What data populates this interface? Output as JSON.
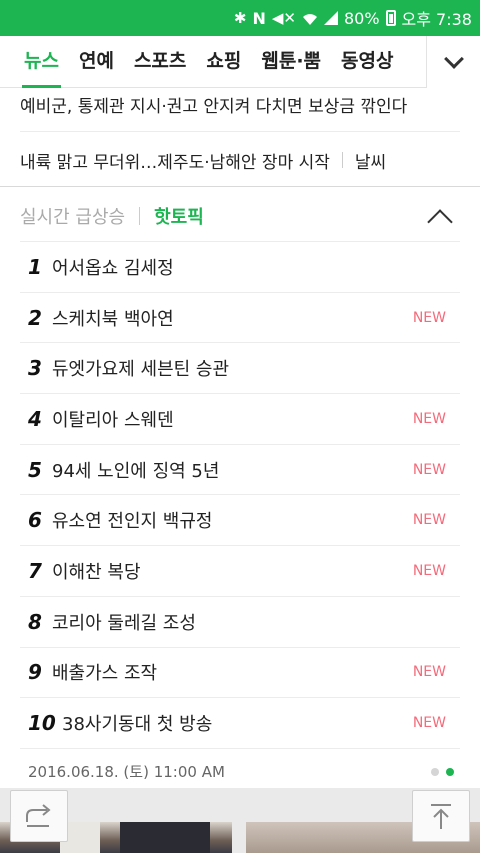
{
  "status_bar": {
    "battery": "80%",
    "time": "오후 7:38",
    "icons": [
      "bluetooth-icon",
      "n-icon",
      "mute-icon",
      "wifi-icon",
      "signal-icon",
      "battery-icon"
    ]
  },
  "tabs": [
    {
      "label": "뉴스",
      "active": true
    },
    {
      "label": "연예"
    },
    {
      "label": "스포츠"
    },
    {
      "label": "쇼핑"
    },
    {
      "label": "웹툰·뿜"
    },
    {
      "label": "동영상"
    }
  ],
  "headlines": {
    "h1": "예비군, 통제관 지시·권고 안지켜 다치면 보상금 깎인다",
    "h2": "내륙 맑고 무더위…제주도·남해안 장마 시작",
    "h2_tag": "날씨"
  },
  "realtime": {
    "tab1": "실시간 급상승",
    "tab2": "핫토픽",
    "items": [
      {
        "rank": "1",
        "text": "어서옵쇼 김세정",
        "new": ""
      },
      {
        "rank": "2",
        "text": "스케치북 백아연",
        "new": "NEW"
      },
      {
        "rank": "3",
        "text": "듀엣가요제 세븐틴 승관",
        "new": ""
      },
      {
        "rank": "4",
        "text": "이탈리아 스웨덴",
        "new": "NEW"
      },
      {
        "rank": "5",
        "text": "94세 노인에 징역 5년",
        "new": "NEW"
      },
      {
        "rank": "6",
        "text": "유소연 전인지 백규정",
        "new": "NEW"
      },
      {
        "rank": "7",
        "text": "이해찬 복당",
        "new": "NEW"
      },
      {
        "rank": "8",
        "text": "코리아 둘레길 조성",
        "new": ""
      },
      {
        "rank": "9",
        "text": "배출가스 조작",
        "new": "NEW"
      },
      {
        "rank": "10",
        "text": "38사기동대 첫 방송",
        "new": "NEW"
      }
    ],
    "timestamp": "2016.06.18. (토) 11:00 AM"
  },
  "colors": {
    "brand_green": "#1db552",
    "new_red": "#f46b7b"
  }
}
